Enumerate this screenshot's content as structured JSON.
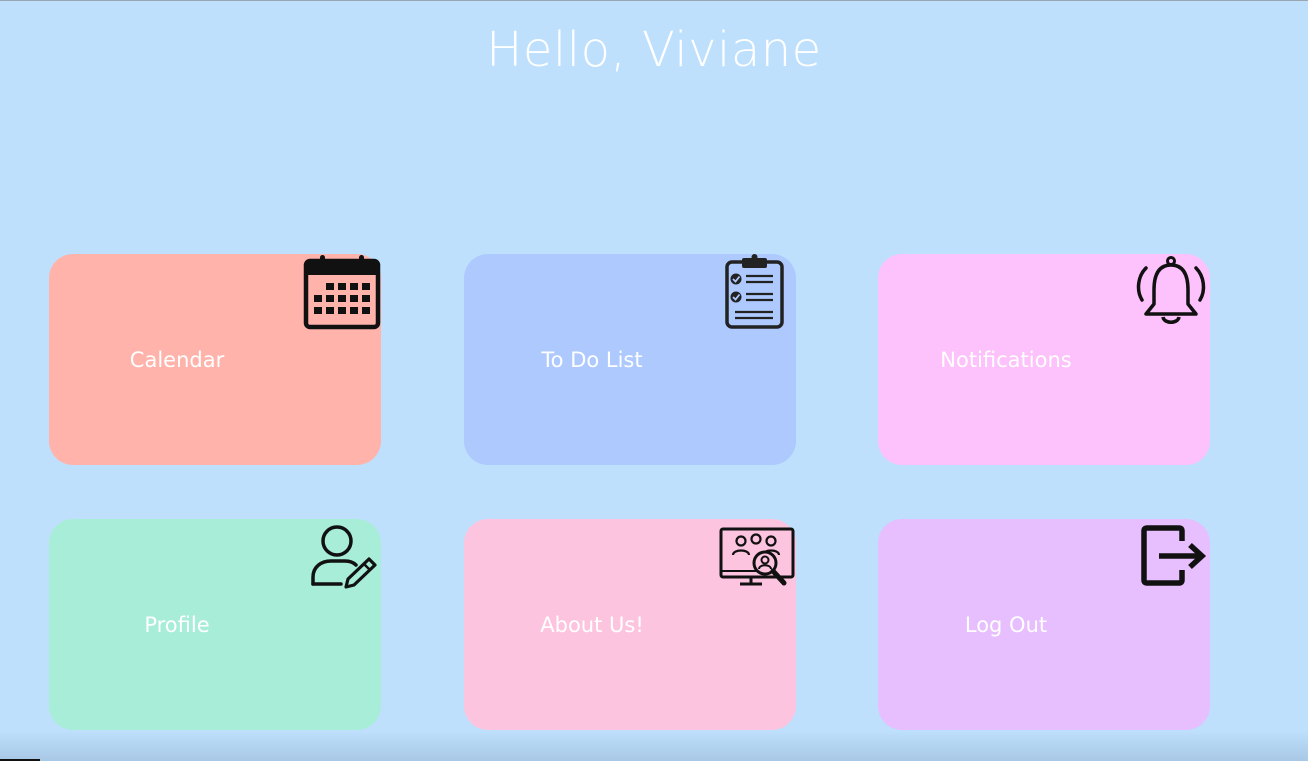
{
  "greeting": "Hello, Viviane",
  "tiles": [
    {
      "label": "Calendar",
      "color": "#ffb3ab",
      "icon": "calendar-icon"
    },
    {
      "label": "To Do List",
      "color": "#adc9fe",
      "icon": "clipboard-checklist-icon"
    },
    {
      "label": "Notifications",
      "color": "#fdc1fb",
      "icon": "bell-icon"
    },
    {
      "label": "Profile",
      "color": "#a8edd7",
      "icon": "user-edit-icon"
    },
    {
      "label": "About Us!",
      "color": "#fdc4e0",
      "icon": "team-search-icon"
    },
    {
      "label": "Log Out",
      "color": "#e7befe",
      "icon": "logout-icon"
    }
  ],
  "colors": {
    "background": "#bee0fc",
    "text": "#ffffff",
    "icon": "#111111"
  }
}
